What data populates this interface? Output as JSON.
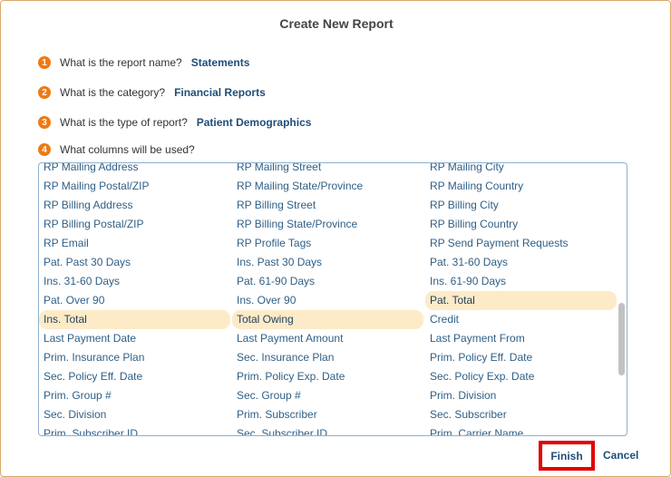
{
  "dialog": {
    "title": "Create New Report"
  },
  "questions": [
    {
      "num": "1",
      "text": "What is the report name?",
      "answer": "Statements"
    },
    {
      "num": "2",
      "text": "What is the category?",
      "answer": "Financial Reports"
    },
    {
      "num": "3",
      "text": "What is the type of report?",
      "answer": "Patient Demographics"
    },
    {
      "num": "4",
      "text": "What columns will be used?",
      "answer": ""
    }
  ],
  "columns": [
    {
      "label": "RP Mailing Address",
      "selected": false
    },
    {
      "label": "RP Mailing Street",
      "selected": false
    },
    {
      "label": "RP Mailing City",
      "selected": false
    },
    {
      "label": "RP Mailing Postal/ZIP",
      "selected": false
    },
    {
      "label": "RP Mailing State/Province",
      "selected": false
    },
    {
      "label": "RP Mailing Country",
      "selected": false
    },
    {
      "label": "RP Billing Address",
      "selected": false
    },
    {
      "label": "RP Billing Street",
      "selected": false
    },
    {
      "label": "RP Billing City",
      "selected": false
    },
    {
      "label": "RP Billing Postal/ZIP",
      "selected": false
    },
    {
      "label": "RP Billing State/Province",
      "selected": false
    },
    {
      "label": "RP Billing Country",
      "selected": false
    },
    {
      "label": "RP Email",
      "selected": false
    },
    {
      "label": "RP Profile Tags",
      "selected": false
    },
    {
      "label": "RP Send Payment Requests",
      "selected": false
    },
    {
      "label": "Pat. Past 30 Days",
      "selected": false
    },
    {
      "label": "Ins. Past 30 Days",
      "selected": false
    },
    {
      "label": "Pat. 31-60 Days",
      "selected": false
    },
    {
      "label": "Ins. 31-60 Days",
      "selected": false
    },
    {
      "label": "Pat. 61-90 Days",
      "selected": false
    },
    {
      "label": "Ins. 61-90 Days",
      "selected": false
    },
    {
      "label": "Pat. Over 90",
      "selected": false
    },
    {
      "label": "Ins. Over 90",
      "selected": false
    },
    {
      "label": "Pat. Total",
      "selected": true
    },
    {
      "label": "Ins. Total",
      "selected": true
    },
    {
      "label": "Total Owing",
      "selected": true
    },
    {
      "label": "Credit",
      "selected": false
    },
    {
      "label": "Last Payment Date",
      "selected": false
    },
    {
      "label": "Last Payment Amount",
      "selected": false
    },
    {
      "label": "Last Payment From",
      "selected": false
    },
    {
      "label": "Prim. Insurance Plan",
      "selected": false
    },
    {
      "label": "Sec. Insurance Plan",
      "selected": false
    },
    {
      "label": "Prim. Policy Eff. Date",
      "selected": false
    },
    {
      "label": "Sec. Policy Eff. Date",
      "selected": false
    },
    {
      "label": "Prim. Policy Exp. Date",
      "selected": false
    },
    {
      "label": "Sec. Policy Exp. Date",
      "selected": false
    },
    {
      "label": "Prim. Group #",
      "selected": false
    },
    {
      "label": "Sec. Group #",
      "selected": false
    },
    {
      "label": "Prim. Division",
      "selected": false
    },
    {
      "label": "Sec. Division",
      "selected": false
    },
    {
      "label": "Prim. Subscriber",
      "selected": false
    },
    {
      "label": "Sec. Subscriber",
      "selected": false
    },
    {
      "label": "Prim. Subscriber ID",
      "selected": false
    },
    {
      "label": "Sec. Subscriber ID",
      "selected": false
    },
    {
      "label": "Prim. Carrier Name",
      "selected": false
    }
  ],
  "buttons": {
    "finish": "Finish",
    "cancel": "Cancel"
  }
}
